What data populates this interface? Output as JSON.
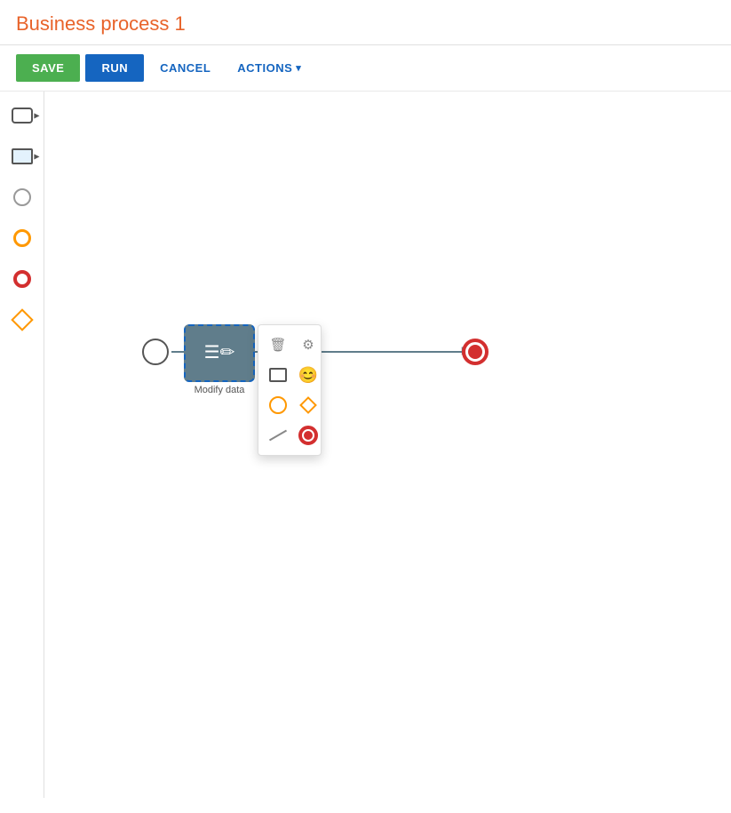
{
  "header": {
    "title": "Business process 1"
  },
  "toolbar": {
    "save_label": "SAVE",
    "run_label": "RUN",
    "cancel_label": "CANCEL",
    "actions_label": "ACTIONS"
  },
  "sidebar": {
    "items": [
      {
        "id": "task",
        "tooltip": "Task"
      },
      {
        "id": "subprocess",
        "tooltip": "Sub-process"
      },
      {
        "id": "circle-plain",
        "tooltip": "Start event"
      },
      {
        "id": "circle-orange",
        "tooltip": "Intermediate event"
      },
      {
        "id": "circle-red",
        "tooltip": "End event"
      },
      {
        "id": "diamond",
        "tooltip": "Gateway"
      }
    ]
  },
  "diagram": {
    "task_label": "Modify data",
    "start_tooltip": "Start event",
    "end_tooltip": "End event"
  },
  "context_menu": {
    "items": [
      {
        "id": "delete",
        "icon": "🗑",
        "tooltip": "Delete"
      },
      {
        "id": "settings",
        "icon": "⚙",
        "tooltip": "Settings"
      },
      {
        "id": "task",
        "icon": "",
        "tooltip": "Task"
      },
      {
        "id": "intermediate",
        "icon": "",
        "tooltip": "Intermediate event"
      },
      {
        "id": "start",
        "icon": "",
        "tooltip": "Start event"
      },
      {
        "id": "gateway",
        "icon": "",
        "tooltip": "Gateway"
      },
      {
        "id": "line",
        "icon": "",
        "tooltip": "Connection"
      },
      {
        "id": "end",
        "icon": "",
        "tooltip": "End event"
      }
    ]
  }
}
